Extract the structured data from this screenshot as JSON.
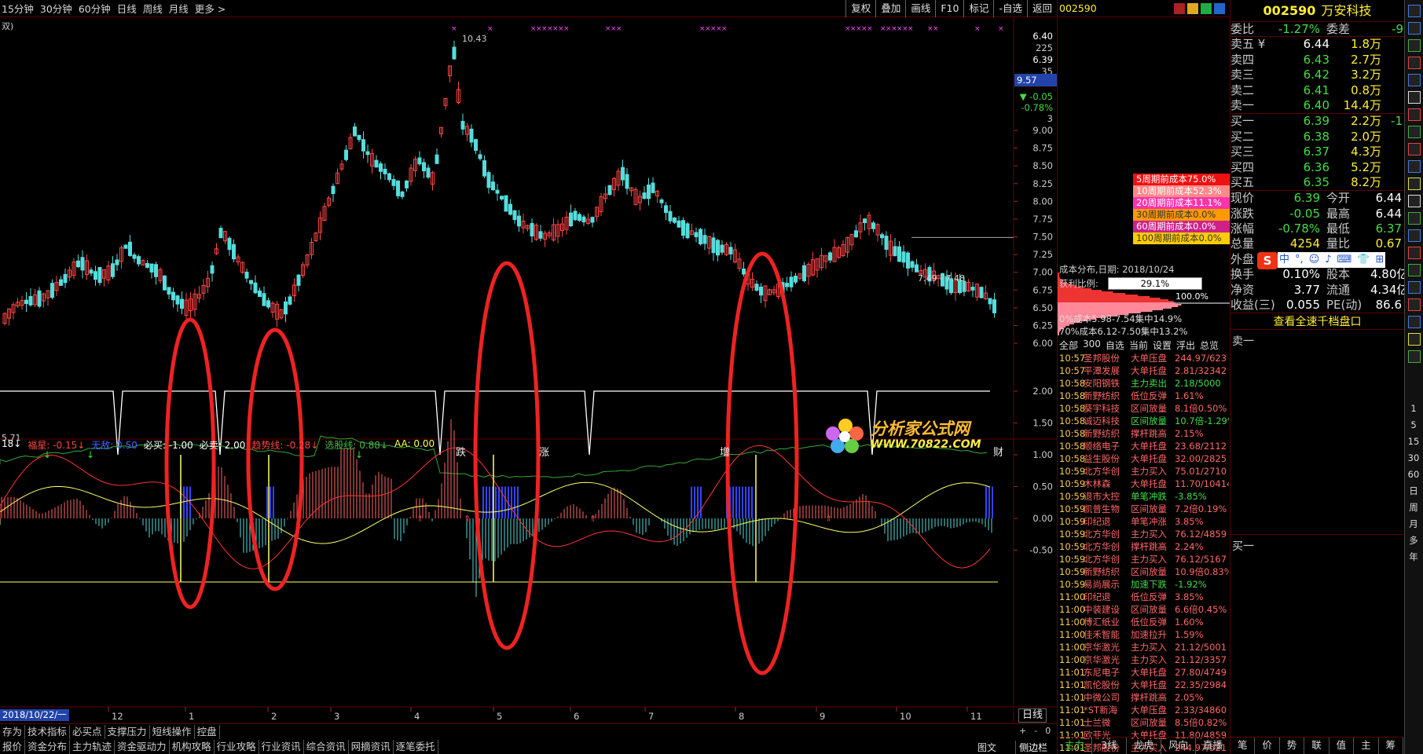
{
  "toolbar": {
    "periods": [
      "15分钟",
      "30分钟",
      "60分钟",
      "日线",
      "周线",
      "月线",
      "更多 >"
    ],
    "buttons": [
      "复权",
      "叠加",
      "画线",
      "F10",
      "标记",
      "-自选",
      "返回"
    ]
  },
  "chart_title_fragment": "双)",
  "price_axis": [
    "6.40",
    "225",
    "6.39",
    "35",
    "9.57",
    "-0.05",
    "-0.78%",
    "3",
    "9.00",
    "8.75",
    "8.50",
    "8.25",
    "8.00",
    "7.75",
    "7.50",
    "7.25",
    "7.00",
    "6.75",
    "6.50",
    "6.25",
    "6.00"
  ],
  "high_label": "10.43",
  "low_label": "5.71",
  "level_label": "7.49 - 7.48",
  "annotations": [
    "跌",
    "涨",
    "增",
    "财"
  ],
  "watermark": {
    "cn": "分析家公式网",
    "url": "WWW.70822.COM"
  },
  "indicator_bar": {
    "items": [
      {
        "text": "18↓",
        "color": "#ffffff"
      },
      {
        "text": "福星: -0.15↓",
        "color": "#ff4444"
      },
      {
        "text": "无敌: 0.50",
        "color": "#4466ff"
      },
      {
        "text": "必买: -1.00",
        "color": "#ffffff"
      },
      {
        "text": "必卖: 2.00",
        "color": "#ffffff"
      },
      {
        "text": "趋势线: -0.28↓",
        "color": "#ff4444"
      },
      {
        "text": "选股线: 0.88↓",
        "color": "#44bb44"
      },
      {
        "text": "AA: 0.00",
        "color": "#ffff44"
      }
    ]
  },
  "indicator_axis": [
    "2.00",
    "1.50",
    "1.00",
    "0.50",
    "0.00",
    "-0.50"
  ],
  "date_axis": {
    "start": "2018/10/22/一",
    "marks": [
      "12",
      "1",
      "2",
      "3",
      "4",
      "5",
      "6",
      "7",
      "8",
      "9",
      "10",
      "11"
    ],
    "period": "日线"
  },
  "bottom_tabs_1": [
    "存为",
    "技术指标",
    "必买点",
    "支撑压力",
    "短线操作",
    "控盘"
  ],
  "bottom_tabs_2": [
    "报价",
    "资金分布",
    "主力轨迹",
    "资金驱动力",
    "机构攻略",
    "行业攻略",
    "行业资讯",
    "综合资讯",
    "网摘资讯",
    "逐笔委托"
  ],
  "bottom_right": [
    "图文F10",
    "侧边栏<"
  ],
  "mid": {
    "code": "002590",
    "cost_legend": [
      {
        "text": "5周期前成本75.0%",
        "color": "#ee1111"
      },
      {
        "text": "10周期前成本52.3%",
        "color": "#ff8888"
      },
      {
        "text": "20周期前成本11.1%",
        "color": "#ff33aa"
      },
      {
        "text": "30周期前成本0.0%",
        "color": "#ff9900"
      },
      {
        "text": "60周期前成本0.0%",
        "color": "#cc2288"
      },
      {
        "text": "100周期前成本0.0%",
        "color": "#ffcc00"
      }
    ],
    "cost_date_label": "成本分布,日期:",
    "cost_date": "2018/10/24",
    "profit_label": "获利比例:",
    "profit_value": "29.1%",
    "avg_cost_hidden": "100.0%",
    "concentration_90": "0%成本5.98-7.54集中14.9%",
    "concentration_70": "70%成本6.12-7.50集中13.2%",
    "filter_tabs": [
      "全部",
      "300",
      "自选",
      "当前",
      "设置",
      "浮出",
      "总览"
    ],
    "feed": [
      [
        "10:57",
        "圣邦股份",
        "大单压盘",
        "244.97/623",
        "#ff6666",
        "#ff6666"
      ],
      [
        "10:57",
        "平潭发展",
        "大单托盘",
        "2.81/32342",
        "#ff6666",
        "#ff6666"
      ],
      [
        "10:58",
        "安阳钢铁",
        "主力卖出",
        "2.18/5000",
        "#44dd44",
        "#44dd44"
      ],
      [
        "10:58",
        "新野纺织",
        "低位反弹",
        "1.61%",
        "#ff6666",
        "#ff6666"
      ],
      [
        "10:58",
        "葵宇科技",
        "区间放量",
        "8.1倍0.50%",
        "#ff6666",
        "#ff6666"
      ],
      [
        "10:58",
        "诚迈科技",
        "区间放量",
        "10.7倍-1.29%",
        "#44dd44",
        "#44dd44"
      ],
      [
        "10:58",
        "新野纺织",
        "撑杆跳高",
        "2.15%",
        "#ff6666",
        "#ff6666"
      ],
      [
        "10:58",
        "顺络电子",
        "大单托盘",
        "23.68/2112",
        "#ff6666",
        "#ff6666"
      ],
      [
        "10:58",
        "益生股份",
        "大单托盘",
        "32.00/2825",
        "#ff6666",
        "#ff6666"
      ],
      [
        "10:59",
        "北方华创",
        "主力买入",
        "75.01/2710",
        "#ff6666",
        "#ff6666"
      ],
      [
        "10:59",
        "木林森",
        "大单托盘",
        "11.70/10414",
        "#ff6666",
        "#ff6666"
      ],
      [
        "10:59",
        "退市大控",
        "单笔冲跌",
        "-3.85%",
        "#44dd44",
        "#44dd44"
      ],
      [
        "10:59",
        "凯普生物",
        "区间放量",
        "7.2倍0.19%",
        "#ff6666",
        "#ff6666"
      ],
      [
        "10:59",
        "印纪退",
        "单笔冲涨",
        "3.85%",
        "#ff6666",
        "#ff6666"
      ],
      [
        "10:59",
        "北方华创",
        "主力买入",
        "76.12/4859",
        "#ff6666",
        "#ff6666"
      ],
      [
        "10:59",
        "北方华创",
        "撑杆跳高",
        "2.24%",
        "#ff6666",
        "#ff6666"
      ],
      [
        "10:59",
        "北方华创",
        "主力买入",
        "76.12/5167",
        "#ff6666",
        "#ff6666"
      ],
      [
        "10:59",
        "新野纺织",
        "区间放量",
        "10.9倍0.83%",
        "#ff6666",
        "#ff6666"
      ],
      [
        "10:59",
        "易尚展示",
        "加速下跌",
        "-1.92%",
        "#44dd44",
        "#44dd44"
      ],
      [
        "11:00",
        "印纪退",
        "低位反弹",
        "3.85%",
        "#ff6666",
        "#ff6666"
      ],
      [
        "11:00",
        "中装建设",
        "区间放量",
        "6.6倍0.45%",
        "#ff6666",
        "#ff6666"
      ],
      [
        "11:00",
        "博汇纸业",
        "低位反弹",
        "1.60%",
        "#ff6666",
        "#ff6666"
      ],
      [
        "11:00",
        "佳禾智能",
        "加速拉升",
        "1.59%",
        "#ff6666",
        "#ff6666"
      ],
      [
        "11:00",
        "京华激光",
        "主力买入",
        "21.12/5001",
        "#ff6666",
        "#ff6666"
      ],
      [
        "11:00",
        "京华激光",
        "主力买入",
        "21.12/3357",
        "#ff6666",
        "#ff6666"
      ],
      [
        "11:01",
        "东尼电子",
        "大单托盘",
        "27.80/4749",
        "#ff6666",
        "#ff6666"
      ],
      [
        "11:01",
        "凯伦股份",
        "大单托盘",
        "22.35/2984",
        "#ff6666",
        "#ff6666"
      ],
      [
        "11:01",
        "中微公司",
        "撑杆跳高",
        "2.05%",
        "#ff6666",
        "#ff6666"
      ],
      [
        "11:01",
        "*ST新海",
        "大单压盘",
        "2.33/34860",
        "#ff6666",
        "#ff6666"
      ],
      [
        "11:01",
        "士兰微",
        "区间放量",
        "8.5倍0.82%",
        "#ff6666",
        "#ff6666"
      ],
      [
        "11:01",
        "欧菲光",
        "大单托盘",
        "11.80/4859",
        "#ff6666",
        "#ff6666"
      ],
      [
        "11:01",
        "圣邦股份",
        "主力买入",
        "244.97/521",
        "#ff6666",
        "#ff6666"
      ]
    ],
    "bottom_tabs": [
      "主力",
      "3线",
      "龙虎",
      "风向",
      "直播"
    ]
  },
  "right": {
    "code": "002590",
    "name": "万安科技",
    "weibi_label": "委比",
    "weibi_value": "-1.27%",
    "weicha_label": "委差",
    "weicha_value": "-9",
    "sells": [
      {
        "label": "卖五",
        "flag": "¥",
        "price": "6.44",
        "vol": "1.8万"
      },
      {
        "label": "卖四",
        "flag": "",
        "price": "6.43",
        "vol": "2.7万"
      },
      {
        "label": "卖三",
        "flag": "",
        "price": "6.42",
        "vol": "3.2万"
      },
      {
        "label": "卖二",
        "flag": "",
        "price": "6.41",
        "vol": "0.8万"
      },
      {
        "label": "卖一",
        "flag": "",
        "price": "6.40",
        "vol": "14.4万"
      }
    ],
    "buys": [
      {
        "label": "买一",
        "price": "6.39",
        "vol": "2.2万",
        "extra": "-1"
      },
      {
        "label": "买二",
        "price": "6.38",
        "vol": "2.0万",
        "extra": ""
      },
      {
        "label": "买三",
        "price": "6.37",
        "vol": "4.3万",
        "extra": ""
      },
      {
        "label": "买四",
        "price": "6.36",
        "vol": "5.2万",
        "extra": ""
      },
      {
        "label": "买五",
        "price": "6.35",
        "vol": "8.2万",
        "extra": ""
      }
    ],
    "stats": [
      {
        "l1": "现价",
        "v1": "6.39",
        "c1": "#44dd44",
        "l2": "今开",
        "v2": "6.44",
        "c2": "#ffffff"
      },
      {
        "l1": "涨跌",
        "v1": "-0.05",
        "c1": "#44dd44",
        "l2": "最高",
        "v2": "6.44",
        "c2": "#ffffff"
      },
      {
        "l1": "涨幅",
        "v1": "-0.78%",
        "c1": "#44dd44",
        "l2": "最低",
        "v2": "6.37",
        "c2": "#44dd44"
      },
      {
        "l1": "总量",
        "v1": "4254",
        "c1": "#ffee33",
        "l2": "量比",
        "v2": "0.67",
        "c2": "#ffee33"
      }
    ],
    "outer_label": "外盘",
    "ime_items": [
      "中",
      "°,",
      "☺",
      "♪",
      "⌨",
      "👕",
      "⊞"
    ],
    "stats2": [
      {
        "l1": "换手",
        "v1": "0.10%",
        "l2": "股本",
        "v2": "4.80亿"
      },
      {
        "l1": "净资",
        "v1": "3.77",
        "l2": "流通",
        "v2": "4.34亿"
      },
      {
        "l1": "收益(三)",
        "v1": "0.055",
        "l2": "PE(动)",
        "v2": "86.6"
      }
    ],
    "link": "查看全速千档盘口",
    "sell1": "卖一",
    "buy1": "买一",
    "bottom_tabs": [
      "笔",
      "价",
      "势",
      "联",
      "值",
      "主",
      "筹"
    ]
  },
  "side_icons": [
    "1",
    "5",
    "15",
    "30",
    "60",
    "日",
    "周",
    "月",
    "多",
    "年"
  ],
  "colors": {
    "up": "#ff4444",
    "down": "#55dddd",
    "bg": "#000000",
    "grid": "#5a0000"
  }
}
